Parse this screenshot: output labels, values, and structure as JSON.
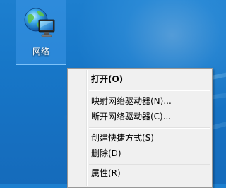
{
  "desktop": {
    "icon": {
      "label": "网络",
      "icon_name": "network-icon",
      "selected": true
    }
  },
  "context_menu": {
    "items": [
      {
        "label": "打开(O)",
        "default": true
      },
      {
        "label": "映射网络驱动器(N)...",
        "default": false
      },
      {
        "label": "断开网络驱动器(C)...",
        "default": false
      },
      {
        "label": "创建快捷方式(S)",
        "default": false
      },
      {
        "label": "删除(D)",
        "default": false
      },
      {
        "label": "属性(R)",
        "default": false
      }
    ]
  },
  "colors": {
    "desktop_background": "#1777c8",
    "menu_background": "#f0f0f0",
    "menu_border": "#979797",
    "selection_fill": "#3d95e6"
  }
}
